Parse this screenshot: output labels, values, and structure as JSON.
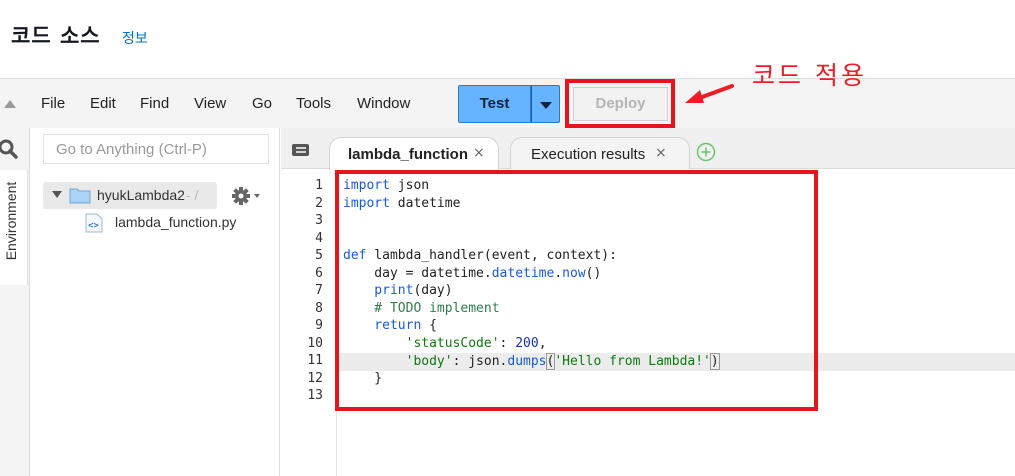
{
  "header": {
    "title": "코드 소스",
    "info_link": "정보"
  },
  "menu": {
    "items": [
      "File",
      "Edit",
      "Find",
      "View",
      "Go",
      "Tools",
      "Window"
    ]
  },
  "toolbar": {
    "test_label": "Test",
    "deploy_label": "Deploy"
  },
  "annotation": {
    "label": "코드 적용",
    "color": "#ee1c25"
  },
  "sidebar": {
    "env_label": "Environment",
    "goto_placeholder": "Go to Anything (Ctrl-P)",
    "root_folder": "hyukLambda2",
    "root_path": "- /",
    "files": [
      "lambda_function.py"
    ]
  },
  "editor": {
    "tabs": [
      {
        "label": "lambda_function",
        "active": true
      },
      {
        "label": "Execution results",
        "active": false
      }
    ],
    "tab_close": "×",
    "line_numbers": [
      "1",
      "2",
      "3",
      "4",
      "5",
      "6",
      "7",
      "8",
      "9",
      "10",
      "11",
      "12",
      "13"
    ],
    "active_line": 11,
    "code": {
      "l1_kw": "import",
      "l1_rest": " json",
      "l2_kw": "import",
      "l2_rest": " datetime",
      "l5_kw": "def",
      "l5_fn": " lambda_handler",
      "l5_rest": "(event, context):",
      "l6_a": "    day = datetime.",
      "l6_b": "datetime",
      "l6_c": ".",
      "l6_d": "now",
      "l6_e": "()",
      "l7_fn": "    print",
      "l7_rest": "(day)",
      "l8_cm": "    # TODO implement",
      "l9_kw": "    return",
      "l9_rest": " {",
      "l10_str": "        'statusCode'",
      "l10_mid": ": ",
      "l10_num": "200",
      "l10_end": ",",
      "l11_str": "        'body'",
      "l11_mid": ": json.",
      "l11_fn": "dumps",
      "l11_open": "(",
      "l11_val": "'Hello from Lambda!'",
      "l11_close": ")",
      "l12": "    }"
    }
  },
  "colors": {
    "accent": "#66b3ff",
    "highlight": "#e8141c",
    "link": "#0073bb"
  }
}
